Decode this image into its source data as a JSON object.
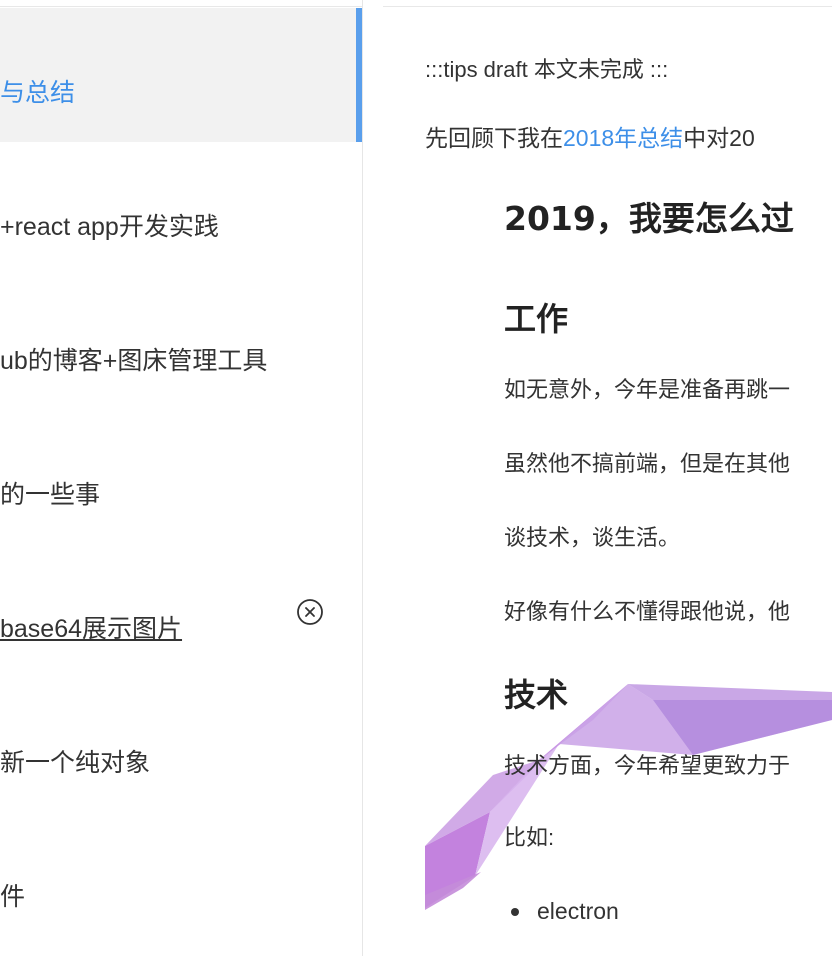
{
  "sidebar": {
    "items": [
      {
        "label": "与总结"
      },
      {
        "label": "+react app开发实践"
      },
      {
        "label": "ub的博客+图床管理工具"
      },
      {
        "label": "的一些事"
      },
      {
        "label": "base64展示图片"
      },
      {
        "label": "新一个纯对象"
      },
      {
        "label": "件"
      }
    ]
  },
  "article": {
    "tips": ":::tips draft 本文未完成 :::",
    "recap_prefix": "先回顾下我在",
    "recap_link": "2018年总结",
    "recap_suffix": "中对20",
    "title": "2019，我要怎么过",
    "section_work": "工作",
    "work_p1": "如无意外，今年是准备再跳一",
    "work_p2": "虽然他不搞前端，但是在其他",
    "work_p3": "谈技术，谈生活。",
    "work_p4": "好像有什么不懂得跟他说，他",
    "section_tech": "技术",
    "tech_p1": "技术方面，今年希望更致力于",
    "tech_p2": "比如:",
    "tech_list": [
      "electron"
    ]
  },
  "colors": {
    "accent": "#3d8fe8",
    "active_bar": "#5a9fec",
    "active_bg": "#f2f2f2",
    "ribbon": "#a566d8"
  },
  "icons": {
    "close": "close-circle-icon"
  }
}
